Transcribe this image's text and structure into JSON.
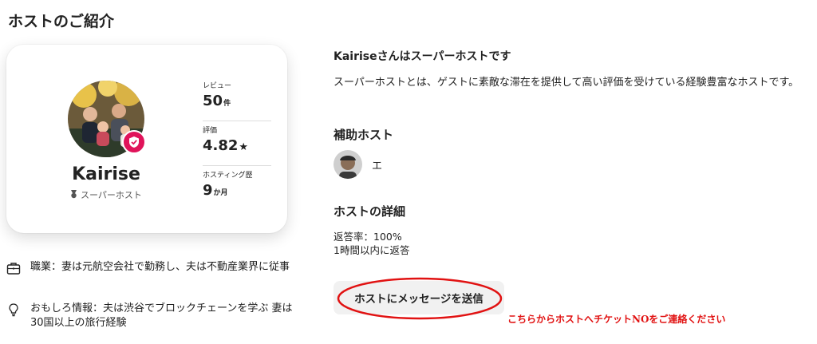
{
  "section_title": "ホストのご紹介",
  "host_card": {
    "name": "Kairise",
    "superhost_label": "スーパーホスト",
    "stats": [
      {
        "label": "レビュー",
        "value": "50",
        "unit": "件"
      },
      {
        "label": "評価",
        "value": "4.82",
        "unit": "★"
      },
      {
        "label": "ホスティング歴",
        "value": "9",
        "unit": "か月"
      }
    ]
  },
  "info": [
    {
      "icon": "briefcase-icon",
      "text": "職業：妻は元航空会社で勤務し、夫は不動産業界に従事"
    },
    {
      "icon": "lightbulb-icon",
      "text": "おもしろ情報：夫は渋谷でブロックチェーンを学ぶ 妻は30国以上の旅行経験"
    }
  ],
  "superhost_section": {
    "title": "Kairiseさんはスーパーホストです",
    "description": "スーパーホストとは、ゲストに素敵な滞在を提供して高い評価を受けている経験豊富なホストです。"
  },
  "cohost": {
    "title": "補助ホスト",
    "name": "エ"
  },
  "host_details": {
    "title": "ホストの詳細",
    "response_rate": "返答率：100%",
    "response_time": "1時間以内に返答"
  },
  "message_button": {
    "label": "ホストにメッセージを送信"
  },
  "annotation": {
    "text": "こちらからホストへチケットNOをご連絡ください",
    "color": "#e11212"
  },
  "colors": {
    "badge": "#e0135a",
    "accent_annotation": "#e11212"
  }
}
